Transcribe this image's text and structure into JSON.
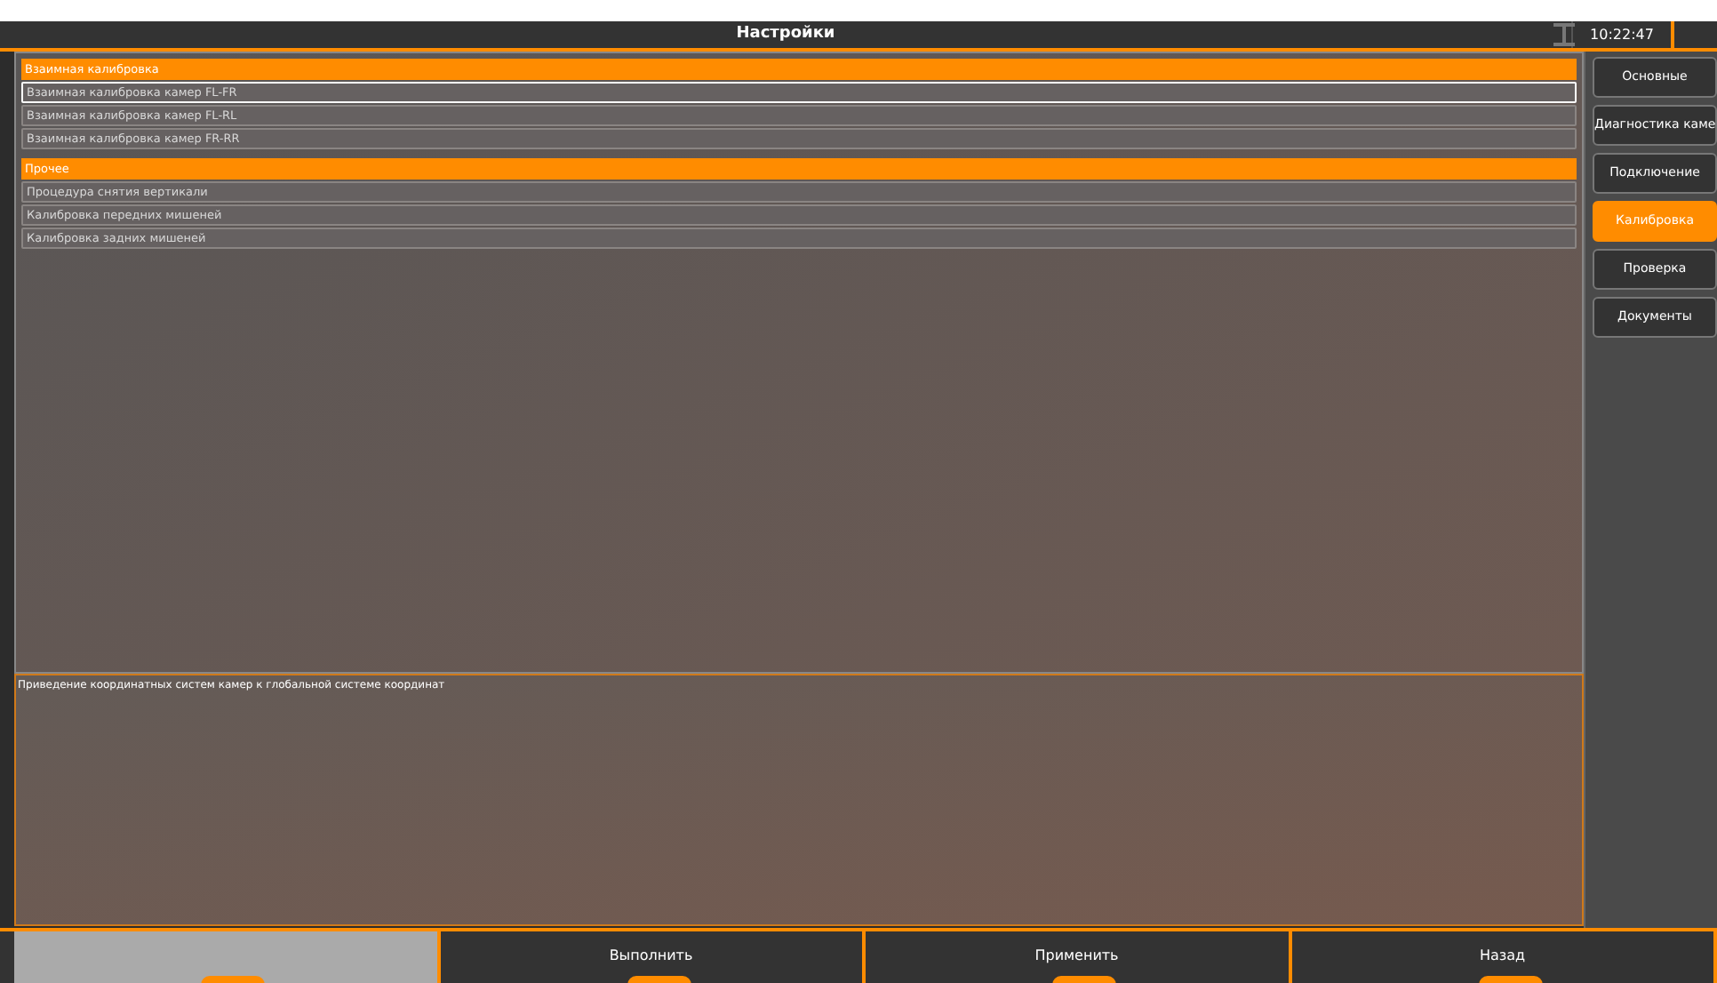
{
  "window": {
    "title": "Настройки",
    "time": "10:22:47"
  },
  "list": [
    {
      "kind": "header",
      "label": "Взаимная калибровка"
    },
    {
      "kind": "item",
      "label": "Взаимная калибровка камер FL-FR",
      "selected": true
    },
    {
      "kind": "item",
      "label": "Взаимная калибровка камер FL-RL",
      "selected": false
    },
    {
      "kind": "item",
      "label": "Взаимная калибровка камер FR-RR",
      "selected": false
    },
    {
      "kind": "header",
      "label": "Прочее"
    },
    {
      "kind": "item",
      "label": "Процедура снятия вертикали",
      "selected": false
    },
    {
      "kind": "item",
      "label": "Калибровка передних мишеней",
      "selected": false
    },
    {
      "kind": "item",
      "label": "Калибровка задних мишеней",
      "selected": false
    }
  ],
  "description": "Приведение координатных систем камер к глобальной системе координат",
  "sidebar": {
    "items": [
      {
        "label": "Основные",
        "selected": false
      },
      {
        "label": "Диагностика каме",
        "selected": false
      },
      {
        "label": "Подключение",
        "selected": false
      },
      {
        "label": "Калибровка",
        "selected": true
      },
      {
        "label": "Проверка",
        "selected": false
      },
      {
        "label": "Документы",
        "selected": false
      }
    ]
  },
  "footer": [
    {
      "disabled": true
    },
    {
      "label": "Выполнить",
      "disabled": false
    },
    {
      "label": "Применить",
      "disabled": false
    },
    {
      "label": "Назад",
      "disabled": false
    }
  ]
}
